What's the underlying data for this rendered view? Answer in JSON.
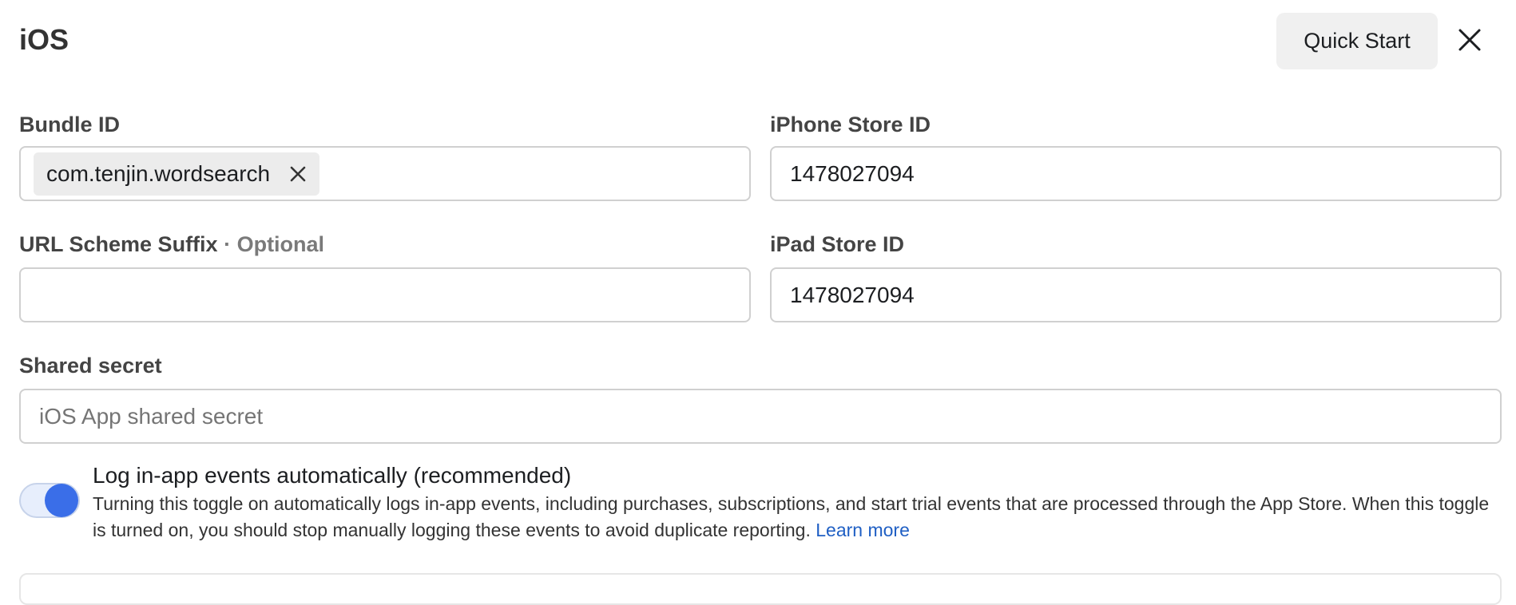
{
  "header": {
    "title": "iOS",
    "quick_start_label": "Quick Start"
  },
  "fields": {
    "bundle_id": {
      "label": "Bundle ID",
      "chip_value": "com.tenjin.wordsearch"
    },
    "iphone_store_id": {
      "label": "iPhone Store ID",
      "value": "1478027094"
    },
    "url_scheme_suffix": {
      "label": "URL Scheme Suffix",
      "optional_label": " · Optional",
      "value": ""
    },
    "ipad_store_id": {
      "label": "iPad Store ID",
      "value": "1478027094"
    },
    "shared_secret": {
      "label": "Shared secret",
      "placeholder": "iOS App shared secret"
    }
  },
  "auto_log": {
    "enabled": true,
    "title": "Log in-app events automatically (recommended)",
    "description": "Turning this toggle on automatically logs in-app events, including purchases, subscriptions, and start trial events that are processed through the App Store. When this toggle is turned on, you should stop manually logging these events to avoid duplicate reporting. ",
    "learn_more_label": "Learn more"
  },
  "colors": {
    "toggle_on": "#3a6ee8",
    "link": "#1f5fc4"
  }
}
